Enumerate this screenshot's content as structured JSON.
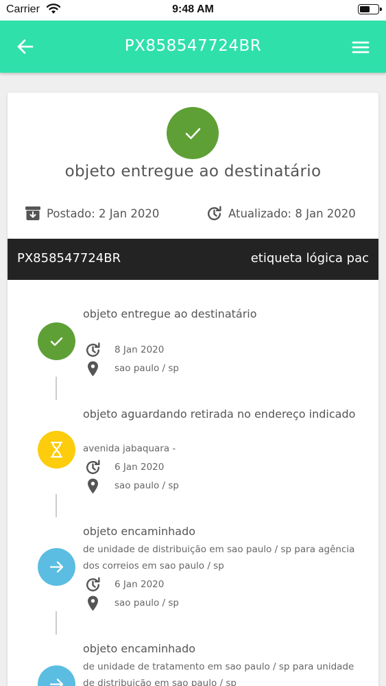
{
  "status_bar": {
    "carrier": "Carrier",
    "time": "9:48 AM",
    "battery_level": 0.55
  },
  "app_bar": {
    "title": "PX858547724BR",
    "back_icon": "arrow-left-icon",
    "menu_icon": "hamburger-menu-icon"
  },
  "summary": {
    "status_icon": "check-icon",
    "status_color": "#5fa036",
    "status_text": "objeto entregue ao destinatário",
    "posted": "Postado: 2 Jan 2020",
    "updated": "Atualizado: 8 Jan 2020"
  },
  "code_bar": {
    "code": "PX858547724BR",
    "service": "etiqueta lógica pac"
  },
  "events": [
    {
      "title": "objeto entregue ao destinatário",
      "detail": "",
      "date": "8 Jan 2020",
      "place": "sao paulo / sp",
      "icon": "check-icon",
      "color": "#5fa036"
    },
    {
      "title": "objeto aguardando retirada no endereço indicado",
      "detail": "avenida jabaquara -",
      "date": "6 Jan 2020",
      "place": "sao paulo / sp",
      "icon": "hourglass-icon",
      "color": "#fccc0d"
    },
    {
      "title": "objeto encaminhado",
      "detail": "de unidade de distribuição em sao paulo / sp para agência dos correios em sao paulo / sp",
      "date": "6 Jan 2020",
      "place": "sao paulo / sp",
      "icon": "arrow-right-icon",
      "color": "#5bbde1"
    },
    {
      "title": "objeto encaminhado",
      "detail": "de unidade de tratamento em sao paulo / sp para unidade de distribuição em sao paulo / sp",
      "date": "",
      "place": "",
      "icon": "arrow-right-icon",
      "color": "#5bbde1"
    }
  ]
}
